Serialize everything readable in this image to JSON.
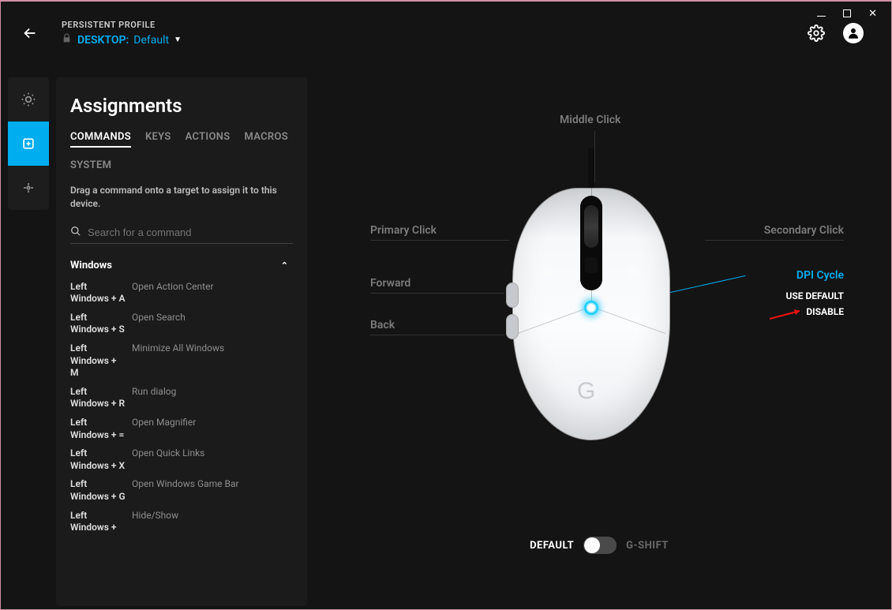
{
  "titlebar": {
    "min": "",
    "max": "",
    "close": "✕"
  },
  "header": {
    "persistent_label": "PERSISTENT PROFILE",
    "profile_prefix": "DESKTOP:",
    "profile_name": "Default"
  },
  "rail": {
    "items": [
      {
        "name": "brightness-icon"
      },
      {
        "name": "assignments-icon"
      },
      {
        "name": "sensitivity-icon"
      }
    ],
    "active_index": 1
  },
  "panel": {
    "title": "Assignments",
    "tabs": [
      "COMMANDS",
      "KEYS",
      "ACTIONS",
      "MACROS",
      "SYSTEM"
    ],
    "active_tab": 0,
    "hint": "Drag a command onto a target to assign it to this device.",
    "search_placeholder": "Search for a command",
    "group_title": "Windows",
    "commands": [
      {
        "shortcut": "Left Windows + A",
        "desc": "Open Action Center"
      },
      {
        "shortcut": "Left Windows + S",
        "desc": "Open Search"
      },
      {
        "shortcut": "Left Windows + M",
        "desc": "Minimize All Windows"
      },
      {
        "shortcut": "Left Windows + R",
        "desc": "Run dialog"
      },
      {
        "shortcut": "Left Windows + =",
        "desc": "Open Magnifier"
      },
      {
        "shortcut": "Left Windows + X",
        "desc": "Open Quick Links"
      },
      {
        "shortcut": "Left Windows + G",
        "desc": "Open Windows Game Bar"
      },
      {
        "shortcut": "Left Windows +",
        "desc": "Hide/Show"
      }
    ]
  },
  "mouse_labels": {
    "middle": "Middle Click",
    "primary": "Primary Click",
    "secondary": "Secondary Click",
    "forward": "Forward",
    "back": "Back",
    "dpi": "DPI Cycle"
  },
  "context_menu": {
    "use_default": "USE DEFAULT",
    "disable": "DISABLE"
  },
  "mode_toggle": {
    "default": "DEFAULT",
    "gshift": "G-SHIFT"
  }
}
